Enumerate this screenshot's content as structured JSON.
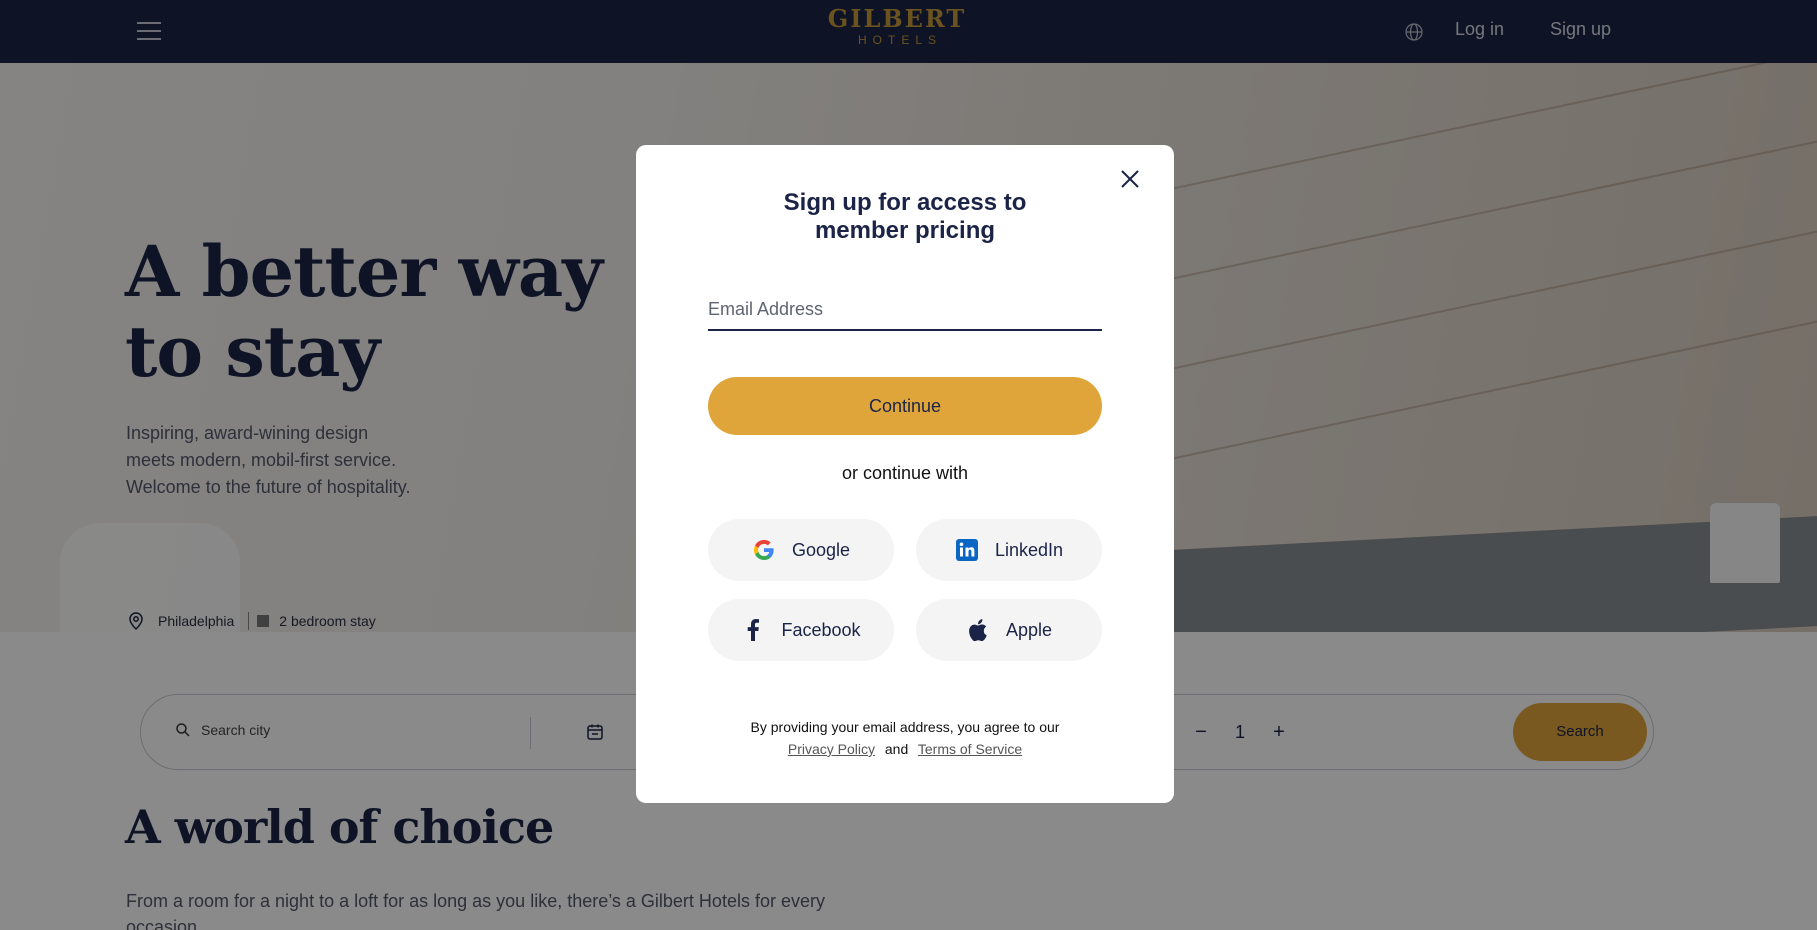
{
  "header": {
    "logo_main": "GILBERT",
    "logo_sub": "HOTELS",
    "login_label": "Log in",
    "signup_label": "Sign up"
  },
  "hero": {
    "title_line1": "A better way",
    "title_line2": "to stay",
    "subtitle_line1": "Inspiring, award-wining design",
    "subtitle_line2": "meets modern, mobil-first service.",
    "subtitle_line3": "Welcome to the future of hospitality.",
    "location": "Philadelphia",
    "stay": "2 bedroom stay"
  },
  "search": {
    "placeholder": "Search city",
    "guests": "1",
    "button_label": "Search"
  },
  "section": {
    "title": "A world of choice",
    "text": "From a room for a night to a loft for as long as you like, there’s a Gilbert Hotels for every occasion."
  },
  "modal": {
    "title_line1": "Sign up for access to",
    "title_line2": "member pricing",
    "email_placeholder": "Email Address",
    "continue_label": "Continue",
    "or_text": "or continue with",
    "providers": {
      "google": "Google",
      "linkedin": "LinkedIn",
      "facebook": "Facebook",
      "apple": "Apple"
    },
    "legal_text": "By providing your email address, you agree to our",
    "privacy_label": "Privacy Policy",
    "and_text": "and",
    "terms_label": "Terms of Service"
  },
  "colors": {
    "navy": "#1b2447",
    "gold": "#dfa53a",
    "overlay": "rgba(0,0,0,0.46)"
  }
}
